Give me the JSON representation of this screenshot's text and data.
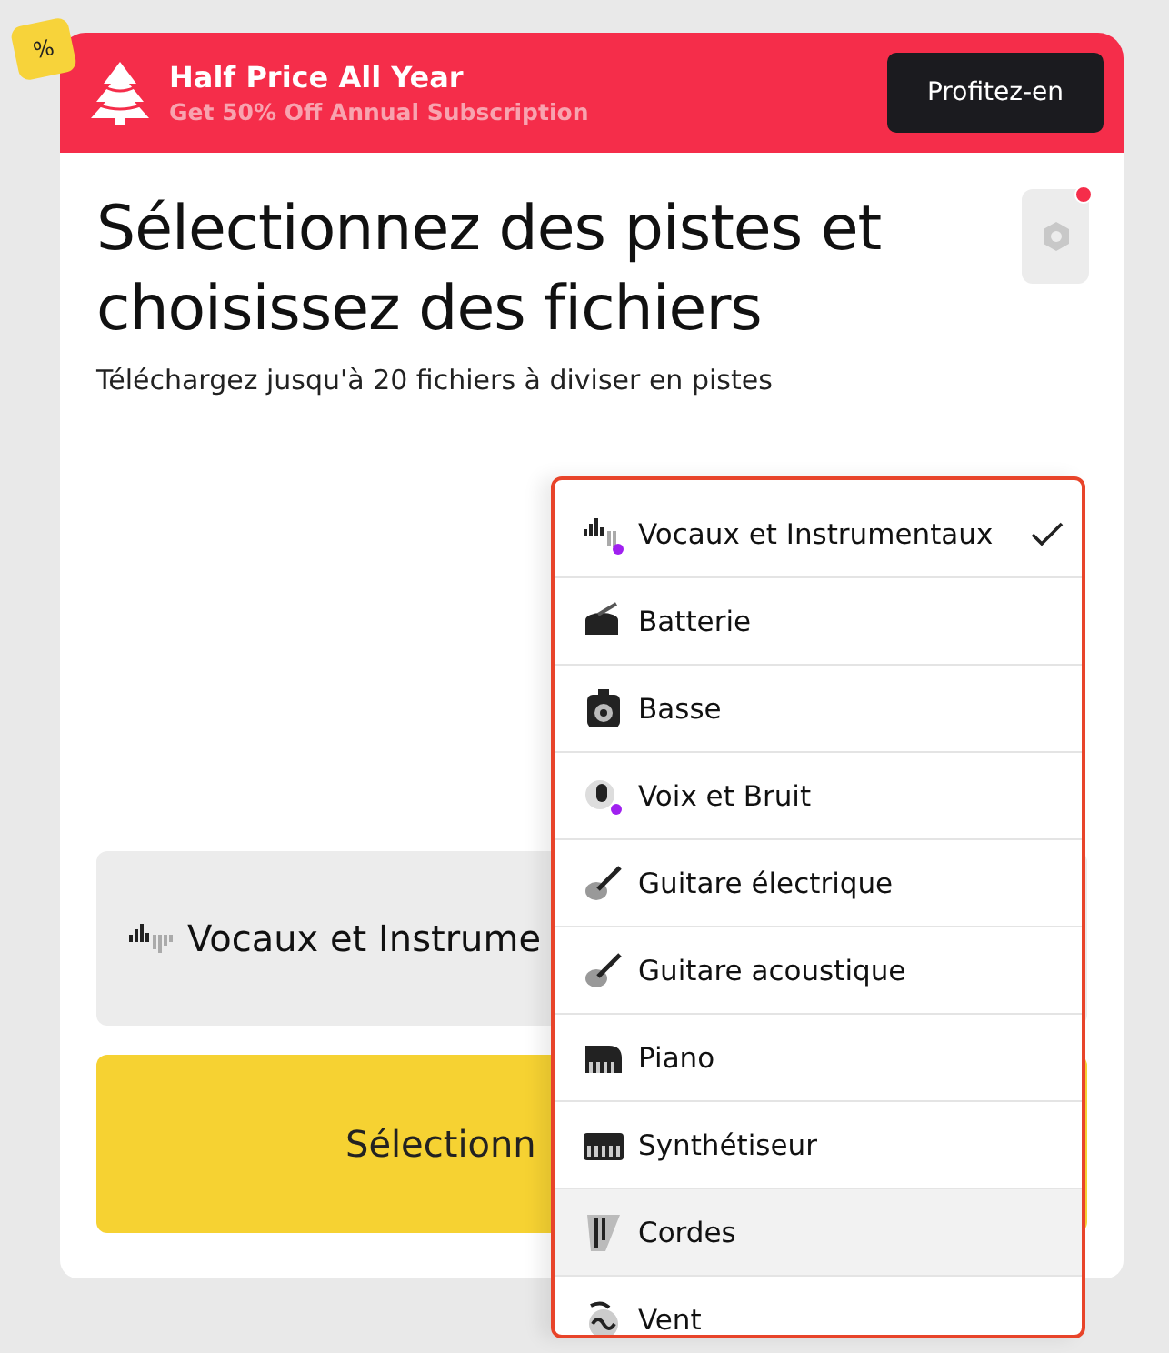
{
  "promo": {
    "badge": "%",
    "title": "Half Price All Year",
    "subtitle": "Get 50% Off Annual Subscription",
    "button": "Profitez-en"
  },
  "heading": "Sélectionnez des pistes et choisissez des fichiers",
  "subheading": "Téléchargez jusqu'à 20 fichiers à diviser en pistes",
  "settings": {
    "notification": true
  },
  "track_select": {
    "value": "Vocaux et Instrume"
  },
  "select_button": "Sélectionn",
  "dropdown": [
    {
      "kind": "vocals",
      "label": "Vocaux et Instrumentaux",
      "selected": true,
      "hovered": false
    },
    {
      "kind": "drums",
      "label": "Batterie",
      "selected": false,
      "hovered": false
    },
    {
      "kind": "bass",
      "label": "Basse",
      "selected": false,
      "hovered": false
    },
    {
      "kind": "voice",
      "label": "Voix et Bruit",
      "selected": false,
      "hovered": false
    },
    {
      "kind": "electric",
      "label": "Guitare électrique",
      "selected": false,
      "hovered": false
    },
    {
      "kind": "acoustic",
      "label": "Guitare acoustique",
      "selected": false,
      "hovered": false
    },
    {
      "kind": "piano",
      "label": "Piano",
      "selected": false,
      "hovered": false
    },
    {
      "kind": "synth",
      "label": "Synthétiseur",
      "selected": false,
      "hovered": false
    },
    {
      "kind": "strings",
      "label": "Cordes",
      "selected": false,
      "hovered": true
    },
    {
      "kind": "wind",
      "label": "Vent",
      "selected": false,
      "hovered": false
    }
  ]
}
